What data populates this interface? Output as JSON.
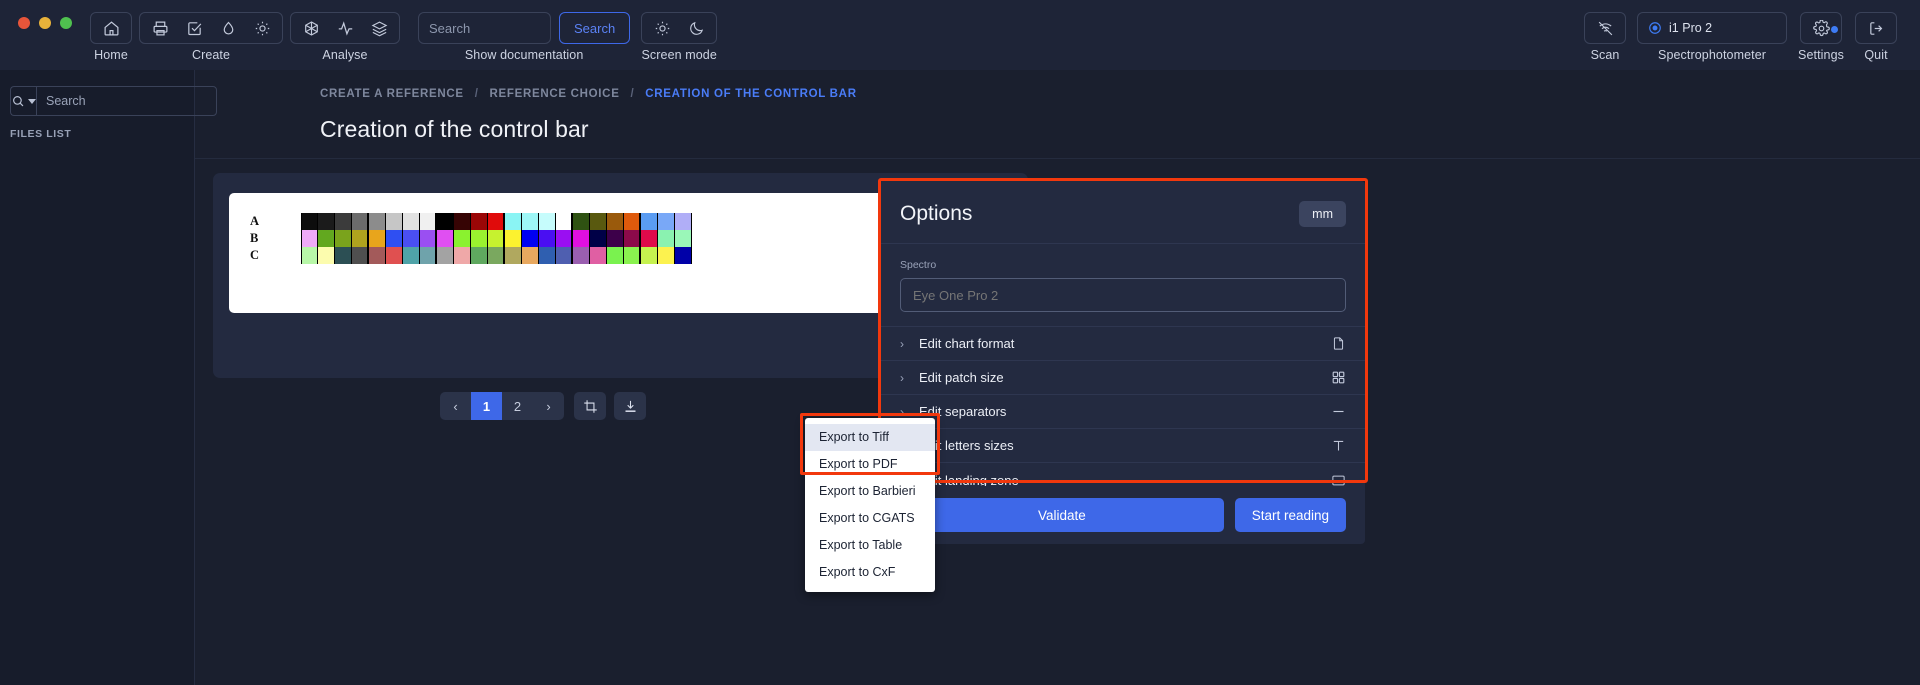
{
  "window": {
    "traffic_lights": [
      "close",
      "minimize",
      "maximize"
    ]
  },
  "toolbar": {
    "groups": [
      {
        "label": "Home",
        "icons": [
          "home-icon"
        ]
      },
      {
        "label": "Create",
        "icons": [
          "printer-icon",
          "check-square-icon",
          "droplet-icon",
          "sun-icon"
        ]
      },
      {
        "label": "Analyse",
        "icons": [
          "cube-icon",
          "activity-icon",
          "layers-icon"
        ]
      }
    ],
    "documentation": {
      "label": "Show documentation",
      "search_placeholder": "Search",
      "search_value": "",
      "search_button": "Search"
    },
    "screen_mode": {
      "label": "Screen mode",
      "icons": [
        "sun-icon",
        "moon-icon"
      ]
    },
    "scan": {
      "label": "Scan",
      "icon": "scan-off-icon"
    },
    "spectrophotometer": {
      "label": "Spectrophotometer",
      "value": "i1 Pro 2",
      "icon": "target-icon"
    },
    "settings": {
      "label": "Settings",
      "icon": "gear-icon",
      "badge": true
    },
    "quit": {
      "label": "Quit",
      "icon": "logout-icon"
    }
  },
  "sidebar": {
    "search_placeholder": "Search",
    "search_value": "",
    "search_icon": "search-icon",
    "dropdown_icon": "chevron-down-icon",
    "section_title": "FILES LIST"
  },
  "breadcrumb": {
    "items": [
      "CREATE A REFERENCE",
      "REFERENCE CHOICE",
      "CREATION OF THE CONTROL BAR"
    ],
    "separator": "/"
  },
  "page": {
    "title": "Creation of the control bar"
  },
  "chart": {
    "row_labels": [
      "A",
      "B",
      "C"
    ],
    "rows": [
      [
        "#0d0d0d",
        "#1b1b1b",
        "#3b3b3b",
        "#6b6b6b",
        "#8c8c8c",
        "#c6c6c6",
        "#e2e2e2",
        "#f0f0f0",
        "#000000",
        "#360404",
        "#9a0606",
        "#e00b0b",
        "#8af4f4",
        "#9ef7f7",
        "#c6fcfc",
        "#ffffff",
        "#2f5212",
        "#59590f",
        "#9a5a0c",
        "#de5a0c",
        "#5a9cf2",
        "#79a8f7",
        "#b0aef7"
      ],
      [
        "#efaaf7",
        "#62a81f",
        "#7aa31c",
        "#b0a41e",
        "#e8a51c",
        "#2f4ff2",
        "#4a4ff2",
        "#9a4ff2",
        "#e04ff2",
        "#8af22f",
        "#9af22f",
        "#c6f22f",
        "#fcf22f",
        "#0000f2",
        "#4a0ff2",
        "#9a0ff2",
        "#e00fe0",
        "#000047",
        "#3d004a",
        "#8c0a4a",
        "#e00a4a",
        "#8af2b0",
        "#9af7b8"
      ],
      [
        "#b8f7a8",
        "#fcfcae",
        "#2c4f54",
        "#4f4f4f",
        "#a35a5a",
        "#e05050",
        "#4fa3a8",
        "#6fa3ab",
        "#a3a3a3",
        "#efa8a8",
        "#5fa85f",
        "#7aa85f",
        "#b0a85f",
        "#e8a85f",
        "#2f5fb0",
        "#4f5fb0",
        "#9a5fb0",
        "#e05fa3",
        "#7af24f",
        "#8af24f",
        "#c6f24f",
        "#fcf24f",
        "#0000a8"
      ]
    ]
  },
  "pagination": {
    "prev_icon": "chevron-left-icon",
    "next_icon": "chevron-right-icon",
    "pages": [
      "1",
      "2"
    ],
    "active_page": "1"
  },
  "chart_tools": [
    {
      "name": "crop-button",
      "icon": "crop-icon"
    },
    {
      "name": "export-button",
      "icon": "download-icon"
    }
  ],
  "export_menu": {
    "items": [
      {
        "label": "Export to Tiff",
        "highlighted": true
      },
      {
        "label": "Export to PDF",
        "highlighted": false
      },
      {
        "label": "Export to Barbieri",
        "highlighted": false
      },
      {
        "label": "Export to CGATS",
        "highlighted": false
      },
      {
        "label": "Export to Table",
        "highlighted": false
      },
      {
        "label": "Export to CxF",
        "highlighted": false
      }
    ]
  },
  "options": {
    "title": "Options",
    "unit_button": "mm",
    "spectro_label": "Spectro",
    "spectro_value": "Eye One Pro 2",
    "rows": [
      {
        "label": "Edit chart format",
        "icon": "file-icon"
      },
      {
        "label": "Edit patch size",
        "icon": "grid-icon"
      },
      {
        "label": "Edit separators",
        "icon": "minus-icon"
      },
      {
        "label": "Edit letters sizes",
        "icon": "text-icon"
      },
      {
        "label": "Edit landing zone",
        "icon": "landing-zone-icon"
      }
    ],
    "validate_button": "Validate",
    "start_reading_button": "Start reading"
  },
  "colors": {
    "accent": "#3e68e8",
    "highlight_border": "#f2380d",
    "panel_bg": "#232a40",
    "app_bg": "#1a1f2e"
  }
}
